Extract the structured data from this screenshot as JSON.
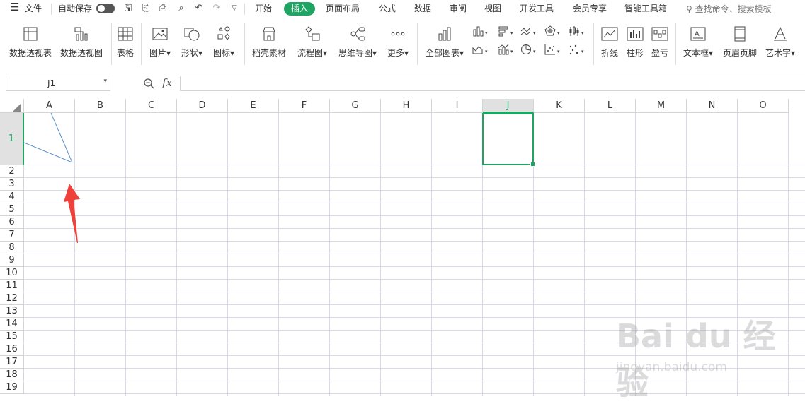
{
  "menubar": {
    "hamburger_icon": "menu-icon",
    "file_label": "文件",
    "autosave_label": "自动保存",
    "tabs": [
      "开始",
      "插入",
      "页面布局",
      "公式",
      "数据",
      "审阅",
      "视图",
      "开发工具",
      "会员专享",
      "智能工具箱"
    ],
    "active_tab": "插入",
    "search_placeholder": "查找命令、搜索模板",
    "accent_color": "#1fa463"
  },
  "ribbon": {
    "buttons": {
      "pivot_table": "数据透视表",
      "pivot_chart": "数据透视图",
      "table": "表格",
      "picture": "图片",
      "shape": "形状",
      "icon": "图标",
      "daoke": "稻壳素材",
      "flowchart": "流程图",
      "mindmap": "思维导图",
      "more": "更多",
      "all_charts": "全部图表",
      "line": "折线",
      "column": "柱形",
      "winloss": "盈亏",
      "textbox": "文本框",
      "header_footer": "页眉页脚",
      "wordart": "艺术字"
    }
  },
  "formula_bar": {
    "name_box": "J1",
    "fx_label": "fx",
    "formula_value": ""
  },
  "sheet": {
    "columns": [
      "A",
      "B",
      "C",
      "D",
      "E",
      "F",
      "G",
      "H",
      "I",
      "J",
      "K",
      "L",
      "M",
      "N",
      "O"
    ],
    "rows": [
      "1",
      "2",
      "3",
      "4",
      "5",
      "6",
      "7",
      "8",
      "9",
      "10",
      "11",
      "12",
      "13",
      "14",
      "15",
      "16",
      "17",
      "18",
      "19"
    ],
    "selected_cell": "J1",
    "selected_column": "J",
    "selected_row": "1"
  },
  "watermark": {
    "brand": "Bai du 经验",
    "url": "jingyan.baidu.com"
  },
  "colors": {
    "accent": "#1fa463",
    "arrow": "#f0403a",
    "diagonal_lines": "#5a8fc8"
  }
}
